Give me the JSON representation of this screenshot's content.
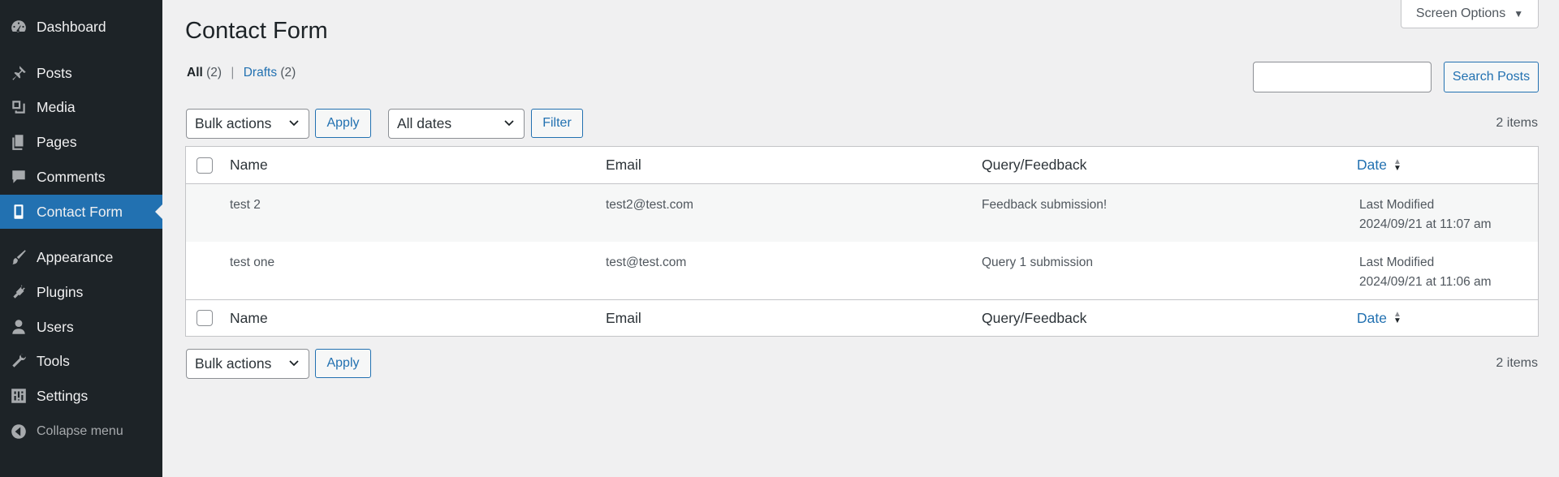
{
  "sidebar": {
    "items": [
      {
        "label": "Dashboard",
        "icon": "dashboard-icon"
      },
      {
        "label": "Posts",
        "icon": "pin-icon"
      },
      {
        "label": "Media",
        "icon": "media-icon"
      },
      {
        "label": "Pages",
        "icon": "pages-icon"
      },
      {
        "label": "Comments",
        "icon": "comment-icon"
      },
      {
        "label": "Contact Form",
        "icon": "phone-icon",
        "active": true
      },
      {
        "label": "Appearance",
        "icon": "brush-icon"
      },
      {
        "label": "Plugins",
        "icon": "plugin-icon"
      },
      {
        "label": "Users",
        "icon": "user-icon"
      },
      {
        "label": "Tools",
        "icon": "wrench-icon"
      },
      {
        "label": "Settings",
        "icon": "settings-icon"
      }
    ],
    "collapse_label": "Collapse menu",
    "bg_color": "#1d2327",
    "active_color": "#2271b1"
  },
  "header": {
    "title": "Contact Form",
    "screen_options": "Screen Options"
  },
  "views": {
    "all_label": "All",
    "all_count": "(2)",
    "separator": "|",
    "drafts_label": "Drafts",
    "drafts_count": "(2)"
  },
  "search": {
    "value": "",
    "button": "Search Posts"
  },
  "tablenav_top": {
    "bulk_actions": "Bulk actions",
    "apply": "Apply",
    "dates": "All dates",
    "filter": "Filter",
    "items": "2 items"
  },
  "tablenav_bottom": {
    "bulk_actions": "Bulk actions",
    "apply": "Apply",
    "items": "2 items"
  },
  "table": {
    "columns": [
      "Name",
      "Email",
      "Query/Feedback",
      "Date"
    ],
    "rows": [
      {
        "name": "test 2",
        "email": "test2@test.com",
        "query": "Feedback submission!",
        "date_status": "Last Modified",
        "date": "2024/09/21 at 11:07 am"
      },
      {
        "name": "test one",
        "email": "test@test.com",
        "query": "Query 1 submission",
        "date_status": "Last Modified",
        "date": "2024/09/21 at 11:06 am"
      }
    ]
  },
  "colors": {
    "link": "#2271b1",
    "background": "#f0f0f1"
  }
}
